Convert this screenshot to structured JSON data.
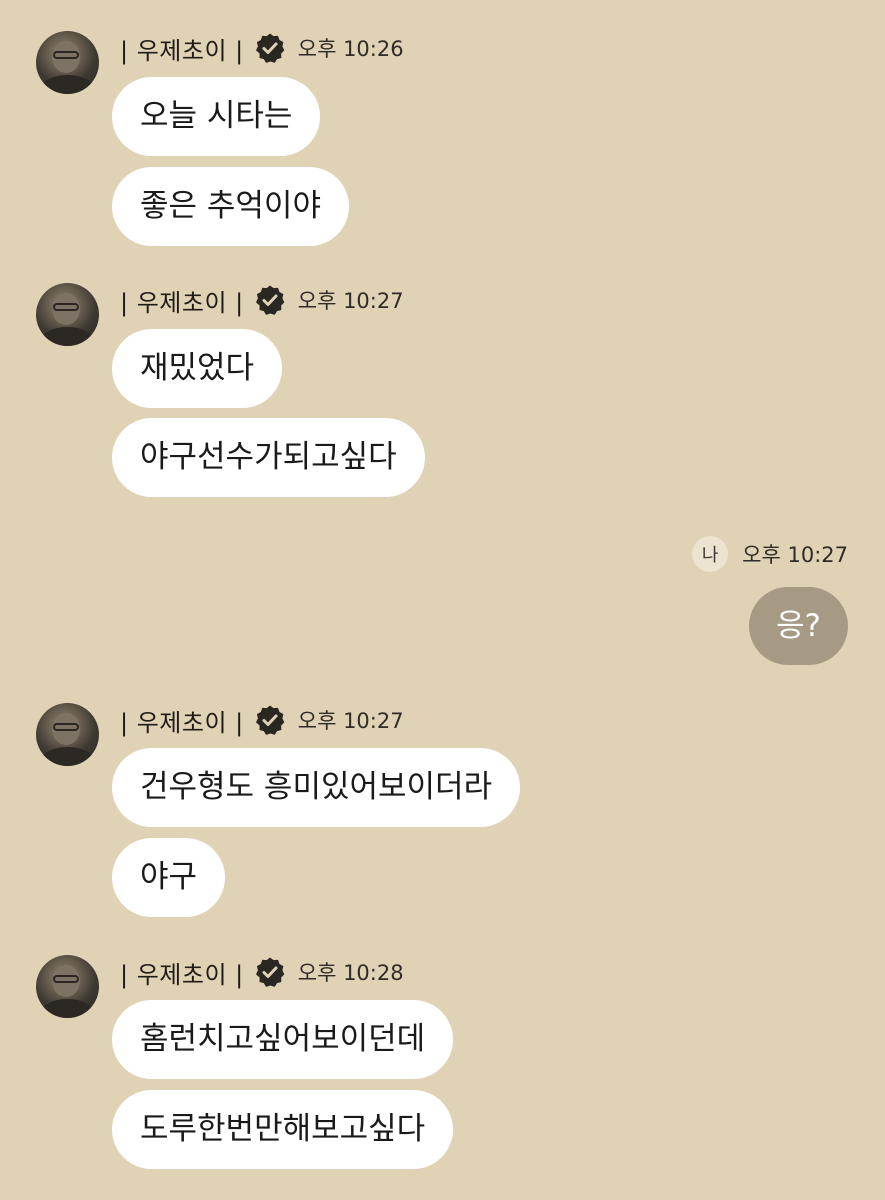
{
  "messages": [
    {
      "sender": "| 우제초이 |",
      "time": "오후 10:26",
      "bubbles": [
        "오늘 시타는",
        "좋은 추억이야"
      ]
    },
    {
      "sender": "| 우제초이 |",
      "time": "오후 10:27",
      "bubbles": [
        "재밌었다",
        "야구선수가되고싶다"
      ]
    },
    {
      "sender": "| 우제초이 |",
      "time": "오후 10:27",
      "bubbles": [
        "건우형도 흥미있어보이더라",
        "야구"
      ]
    },
    {
      "sender": "| 우제초이 |",
      "time": "오후 10:28",
      "bubbles": [
        "홈런치고싶어보이던데",
        "도루한번만해보고싶다"
      ]
    }
  ],
  "my_message": {
    "badge": "나",
    "time": "오후 10:27",
    "text": "응?"
  },
  "colors": {
    "background": "#e0d2b5",
    "incoming_bubble": "#ffffff",
    "outgoing_bubble": "#a69a85"
  },
  "icons": {
    "verified": "verified-badge-icon",
    "avatar": "profile-avatar"
  }
}
